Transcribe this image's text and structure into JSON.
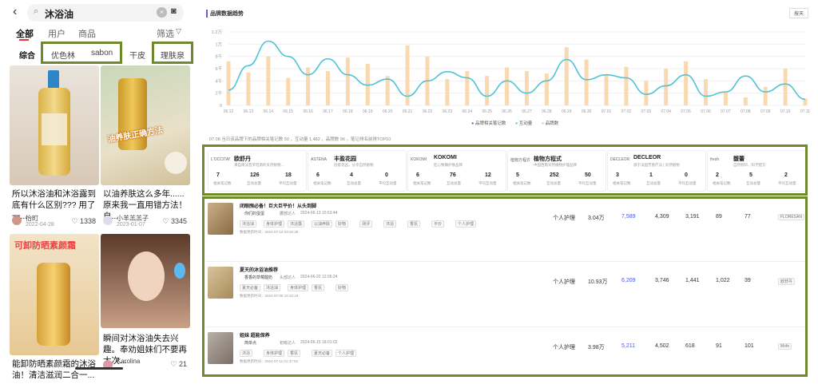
{
  "search": {
    "query": "沐浴油"
  },
  "tabs": [
    "全部",
    "用户",
    "商品"
  ],
  "filter_label": "筛选",
  "chips": [
    "综合",
    "优色林",
    "sabon",
    "干皮",
    "理肤泉"
  ],
  "cards": [
    {
      "title": "所以沐浴油和沐浴露到底有什么区别??? 用了一...",
      "author": "怡町",
      "date": "2022-04-28",
      "likes": "1338"
    },
    {
      "title": "以油养肤这么多年......原来我一直用错方法！ 自...",
      "author": "小羊羔羔子",
      "date": "2023-01-07",
      "likes": "3345"
    },
    {
      "title": "能卸防晒素颜霜的沐浴油！清洁滋润二合一...",
      "author": "",
      "date": "",
      "likes": ""
    },
    {
      "title": "瞬间对沐浴油失去兴趣。奉劝姐妹们不要再太次...",
      "author": "Karolina",
      "date": "",
      "likes": "21"
    }
  ],
  "overlays": {
    "card2": "油养肤正确方法",
    "card3": "可卸防晒素颜霜"
  },
  "dashboard": {
    "title": "品牌数据趋势",
    "btn": "按天",
    "ylabels": [
      "1.2万",
      "1万",
      "8千",
      "6千",
      "4千",
      "2千",
      "0"
    ],
    "xlabels": [
      "06.12",
      "06.13",
      "06.14",
      "06.15",
      "06.16",
      "06.17",
      "06.18",
      "06.19",
      "06.20",
      "06.21",
      "06.22",
      "06.23",
      "06.24",
      "06.25",
      "06.26",
      "06.27",
      "06.28",
      "06.29",
      "06.30",
      "07.01",
      "07.02",
      "07.03",
      "07.04",
      "07.05",
      "07.06",
      "07.07",
      "07.08",
      "07.09",
      "07.10",
      "07.11"
    ],
    "legend": [
      "品牌相关笔记数",
      "互动量",
      "品牌数"
    ],
    "summary": "07.08 当日该品牌下的品牌相关笔记数 50 ，互动量 1,482 ，品牌数 96 ，笔记排名前排TOP10",
    "line_color": "#4ec3d6",
    "bar_color": "#fad8b0"
  },
  "chart_data": {
    "type": "bar",
    "categories": [
      "06.12",
      "06.13",
      "06.14",
      "06.15",
      "06.16",
      "06.17",
      "06.18",
      "06.19",
      "06.20",
      "06.21",
      "06.22",
      "06.23",
      "06.24",
      "06.25",
      "06.26",
      "06.27",
      "06.28",
      "06.29",
      "06.30",
      "07.01",
      "07.02",
      "07.03",
      "07.04",
      "07.05",
      "07.06",
      "07.07",
      "07.08",
      "07.09",
      "07.10",
      "07.11"
    ],
    "series": [
      {
        "name": "品牌数",
        "type": "bar",
        "values": [
          7200,
          5400,
          8000,
          4500,
          6200,
          5600,
          7800,
          6800,
          4800,
          9800,
          8000,
          4300,
          5600,
          4800,
          6200,
          5600,
          5200,
          9500,
          7500,
          5100,
          6300,
          4000,
          6000,
          7200,
          4300,
          2200,
          1300,
          3000,
          6000,
          1100
        ]
      },
      {
        "name": "互动量",
        "type": "line",
        "values": [
          2500,
          6500,
          10500,
          8000,
          5000,
          7600,
          5000,
          3300,
          4300,
          1500,
          4000,
          5500,
          4500,
          1500,
          4000,
          2000,
          4000,
          7500,
          4200,
          5000,
          4500,
          1800,
          3200,
          5000,
          1500,
          2200,
          4800,
          2200,
          3500,
          1000
        ]
      }
    ],
    "ylim": [
      0,
      12000
    ]
  },
  "brands": [
    {
      "logo": "L'OCCITANE",
      "name": "欧舒丹",
      "desc": "来自南法普罗旺斯的天然植物...",
      "notes": "7",
      "notes_label": "相关笔记数",
      "inter": "126",
      "inter_label": "互动总量",
      "avg": "18",
      "avg_label": "平均互动量"
    },
    {
      "logo": "ASTENA",
      "name": "丰盈花园",
      "desc": "创意花园，分享自然植物",
      "notes": "6",
      "notes_label": "相关笔记数",
      "inter": "4",
      "inter_label": "互动总量",
      "avg": "0",
      "avg_label": "平均互动量"
    },
    {
      "logo": "KOKOMI",
      "name": "KOKOMI",
      "desc": "匠心致臻护肤品牌",
      "notes": "6",
      "notes_label": "相关笔记数",
      "inter": "76",
      "inter_label": "互动总量",
      "avg": "12",
      "avg_label": "平均互动量"
    },
    {
      "logo": "植物方程式",
      "name": "植物方程式",
      "desc": "中国西南天然植物护理品牌",
      "notes": "5",
      "notes_label": "相关笔记数",
      "inter": "252",
      "inter_label": "互动总量",
      "avg": "50",
      "avg_label": "平均互动量"
    },
    {
      "logo": "DECLEOR",
      "name": "DECLEOR",
      "desc": "源于法国芳香疗法 | 天然植物",
      "notes": "3",
      "notes_label": "相关笔记数",
      "inter": "1",
      "inter_label": "互动总量",
      "avg": "0",
      "avg_label": "平均互动量"
    },
    {
      "logo": "fresh",
      "name": "馥蕾",
      "desc": "自然原料，科学配方",
      "notes": "2",
      "notes_label": "相关笔记数",
      "inter": "5",
      "inter_label": "互动总量",
      "avg": "2",
      "avg_label": "平均互动量"
    }
  ],
  "notes": [
    {
      "title": "闭眼囤必备！巨大巨平价！从头到脚",
      "author": "你们的蛋蛋",
      "level": "腰部达人",
      "time": "2024-06-13 15:53:44",
      "tags": [
        "沐浴油",
        "身体护理",
        "沐浴露",
        "以油养肤",
        "好物",
        "测评",
        "沐浴",
        "香氛",
        "平价",
        "个人护理"
      ],
      "date": "数据更新时间：2024-07-10 03:26:38",
      "cat": "个人护理",
      "fans": "3.04万",
      "likes": "7,589",
      "collect": "4,309",
      "comment": "3,191",
      "share": "89",
      "other": "77",
      "brand": "FLORESAN"
    },
    {
      "title": "夏天的沐浴油推荐",
      "author": "香香的草莓酸奶",
      "level": "头部达人",
      "time": "2024-06-22 12:06:24",
      "tags": [
        "夏天必备",
        "沐浴油",
        "身体护理",
        "香氛",
        "好物"
      ],
      "date": "数据更新时间：2024-07-08 16:32:19",
      "cat": "个人护理",
      "fans": "10.93万",
      "likes": "6,209",
      "collect": "3,746",
      "comment": "1,441",
      "share": "1,022",
      "other": "39",
      "brand": "欧舒丹"
    },
    {
      "title": "姐妹 超能保养",
      "author": "简单点",
      "level": "初级达人",
      "time": "2024-06-15 18:01:02",
      "tags": [
        "沐浴",
        "身体护理",
        "香氛",
        "夏天必备",
        "个人护理"
      ],
      "date": "数据更新时间：2024-07-11 01:37:52",
      "cat": "个人护理",
      "fans": "3.98万",
      "likes": "5,211",
      "collect": "4,502",
      "comment": "618",
      "share": "91",
      "other": "101",
      "brand": "Mofe"
    }
  ]
}
